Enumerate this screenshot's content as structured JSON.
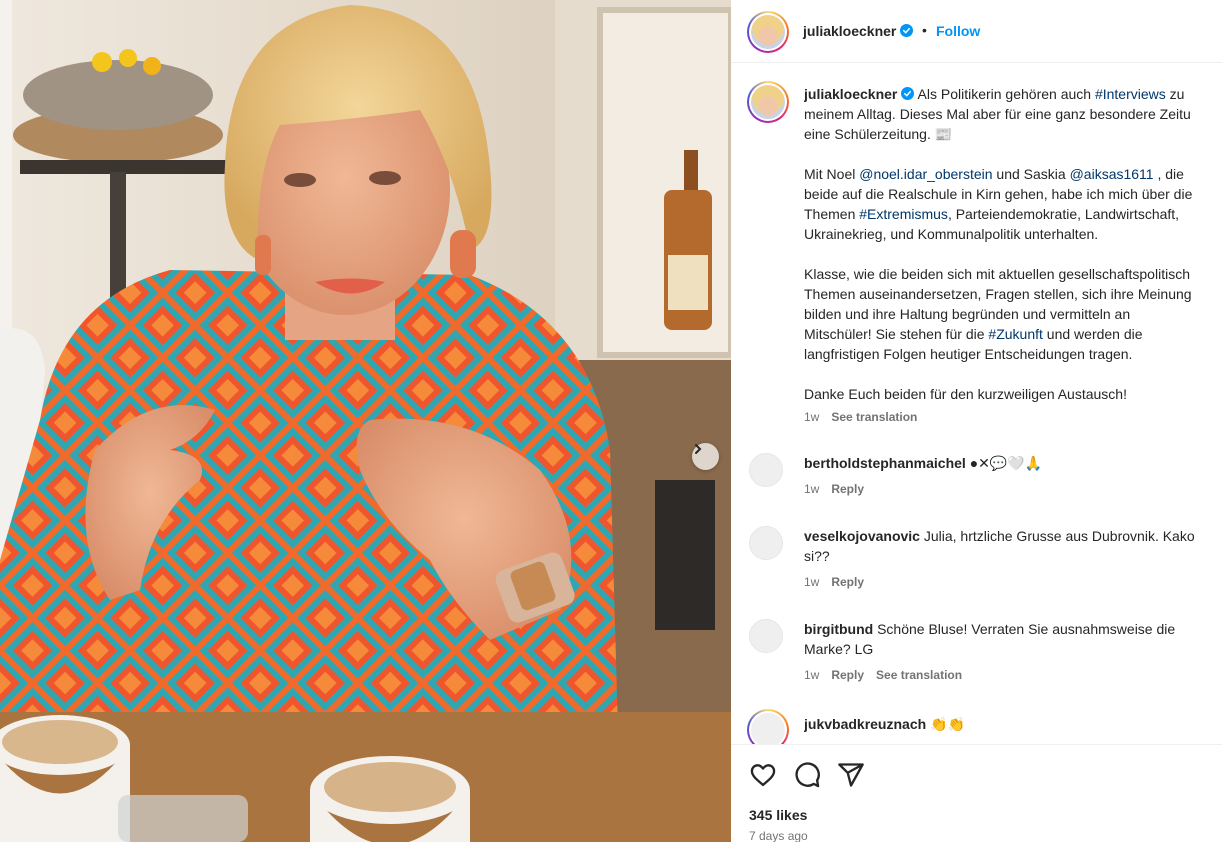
{
  "header": {
    "username": "juliakloeckner",
    "dot": "•",
    "follow_label": "Follow"
  },
  "caption": {
    "username": "juliakloeckner",
    "line1_a": "Als Politikerin gehören auch ",
    "hashtag_interviews": "#Interviews",
    "line1_b": " zu",
    "line2": "meinem Alltag. Dieses Mal aber für eine ganz besondere Zeitu",
    "line3": "eine Schülerzeitung. 📰",
    "p2_a": "Mit Noel ",
    "mention_noel": "@noel.idar_oberstein",
    "p2_b": " und Saskia ",
    "mention_saskia": "@aiksas1611",
    "p2_c": " , die",
    "p2_line2": "beide auf die Realschule in Kirn gehen, habe ich mich über die",
    "p2_line3_a": "Themen ",
    "hashtag_extremismus": "#Extremismus",
    "p2_line3_b": ", Parteiendemokratie, Landwirtschaft,",
    "p2_line4": "Ukrainekrieg, und Kommunalpolitik unterhalten.",
    "p3_line1": "Klasse, wie die beiden sich mit aktuellen gesellschaftspolitisch",
    "p3_line2": "Themen auseinandersetzen, Fragen stellen, sich ihre Meinung",
    "p3_line3": "bilden und ihre Haltung begründen und vermitteln an",
    "p3_line4_a": "Mitschüler! Sie stehen für die ",
    "hashtag_zukunft": "#Zukunft",
    "p3_line4_b": " und werden die",
    "p3_line5": "langfristigen Folgen heutiger Entscheidungen tragen.",
    "p4": "Danke Euch beiden für den kurzweiligen Austausch!",
    "time": "1w",
    "see_translation": "See translation"
  },
  "comments": [
    {
      "username": "bertholdstephanmaichel",
      "text": " ●✕💬🤍🙏",
      "time": "1w",
      "reply": "Reply",
      "see_translation": ""
    },
    {
      "username": "veselkojovanovic",
      "text": " Julia, hrtzliche Grusse aus Dubrovnik. Kako",
      "text2": "si??",
      "time": "1w",
      "reply": "Reply",
      "see_translation": ""
    },
    {
      "username": "birgitbund",
      "text": " Schöne Bluse! Verraten Sie ausnahmsweise die",
      "text2": "Marke? LG",
      "time": "1w",
      "reply": "Reply",
      "see_translation": "See translation"
    },
    {
      "username": "jukvbadkreuznach",
      "text": " 👏👏"
    }
  ],
  "actions": {
    "likes": "345 likes",
    "posted": "7 days ago"
  },
  "icons": {
    "like": "heart-icon",
    "comment": "comment-icon",
    "share": "share-icon",
    "next": "chevron-right-icon",
    "verified": "verified-badge-icon"
  },
  "colors": {
    "link_blue": "#0095f6",
    "hashtag": "#00376b",
    "muted": "#737373"
  }
}
